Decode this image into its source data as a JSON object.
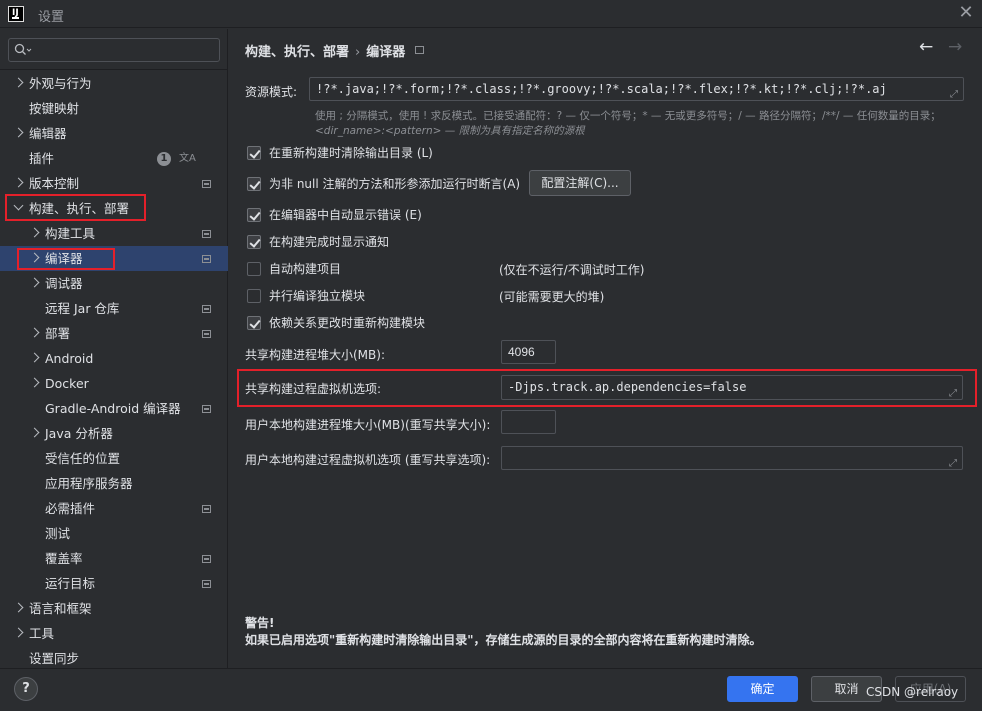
{
  "window": {
    "title": "设置",
    "logo_text": "IJ"
  },
  "sidebar": {
    "search_placeholder": "",
    "items": [
      {
        "label": "外观与行为",
        "chevron": "right"
      },
      {
        "label": "按键映射",
        "chevron": "none"
      },
      {
        "label": "编辑器",
        "chevron": "right"
      },
      {
        "label": "插件",
        "chevron": "none",
        "badge": "1",
        "extra_icon": "translate-icon"
      },
      {
        "label": "版本控制",
        "chevron": "right",
        "pin": true
      },
      {
        "label": "构建、执行、部署",
        "chevron": "down"
      },
      {
        "label": "构建工具",
        "chevron": "right",
        "pin": true
      },
      {
        "label": "编译器",
        "chevron": "right",
        "pin": true,
        "selected": true
      },
      {
        "label": "调试器",
        "chevron": "right"
      },
      {
        "label": "远程 Jar 仓库",
        "chevron": "none",
        "pin": true
      },
      {
        "label": "部署",
        "chevron": "right",
        "pin": true
      },
      {
        "label": "Android",
        "chevron": "right"
      },
      {
        "label": "Docker",
        "chevron": "right"
      },
      {
        "label": "Gradle-Android 编译器",
        "chevron": "none",
        "pin": true
      },
      {
        "label": "Java 分析器",
        "chevron": "right"
      },
      {
        "label": "受信任的位置",
        "chevron": "none"
      },
      {
        "label": "应用程序服务器",
        "chevron": "none"
      },
      {
        "label": "必需插件",
        "chevron": "none",
        "pin": true
      },
      {
        "label": "测试",
        "chevron": "none"
      },
      {
        "label": "覆盖率",
        "chevron": "none",
        "pin": true
      },
      {
        "label": "运行目标",
        "chevron": "none",
        "pin": true
      },
      {
        "label": "语言和框架",
        "chevron": "right"
      },
      {
        "label": "工具",
        "chevron": "right"
      },
      {
        "label": "设置同步",
        "chevron": "none"
      }
    ]
  },
  "header": {
    "breadcrumb_parent": "构建、执行、部署",
    "breadcrumb_sep": "›",
    "breadcrumb_current": "编译器",
    "back_icon": "←",
    "forward_icon": "→"
  },
  "resource": {
    "label": "资源模式:",
    "value": "!?*.java;!?*.form;!?*.class;!?*.groovy;!?*.scala;!?*.flex;!?*.kt;!?*.clj;!?*.aj",
    "hint_line1": "使用 ; 分隔模式，使用 ! 求反模式。已接受通配符：? — 仅一个符号；* — 无或更多符号；/ — 路径分隔符；/**/ — 任何数量的目录；",
    "hint_line2": "<dir_name>:<pattern> — 限制为具有指定名称的源根"
  },
  "options": [
    {
      "label": "在重新构建时清除输出目录 (L)",
      "checked": true
    },
    {
      "label": "为非 null 注解的方法和形参添加运行时断言(A)",
      "checked": true,
      "button": "配置注解(C)..."
    },
    {
      "label": "在编辑器中自动显示错误 (E)",
      "checked": true
    },
    {
      "label": "在构建完成时显示通知",
      "checked": true
    },
    {
      "label": "自动构建项目",
      "checked": false,
      "note": "(仅在不运行/不调试时工作)"
    },
    {
      "label": "并行编译独立模块",
      "checked": false,
      "note": "(可能需要更大的堆)"
    },
    {
      "label": "依赖关系更改时重新构建模块",
      "checked": true
    }
  ],
  "fields": {
    "heap_label": "共享构建进程堆大小(MB):",
    "heap_value": "4096",
    "vm_label": "共享构建过程虚拟机选项:",
    "vm_value": "-Djps.track.ap.dependencies=false",
    "user_heap_label": "用户本地构建进程堆大小(MB)(重写共享大小):",
    "user_heap_value": "",
    "user_vm_label": "用户本地构建过程虚拟机选项 (重写共享选项):",
    "user_vm_value": ""
  },
  "warning": {
    "title": "警告!",
    "text": "如果已启用选项\"重新构建时清除输出目录\"，存储生成源的目录的全部内容将在重新构建时清除。"
  },
  "footer": {
    "help": "?",
    "ok": "确定",
    "cancel": "取消",
    "apply": "应用(A)",
    "watermark": "CSDN @relraoy"
  },
  "colors": {
    "highlight_box": "#e4202a",
    "selection": "#2e436e",
    "primary": "#3574f0"
  }
}
